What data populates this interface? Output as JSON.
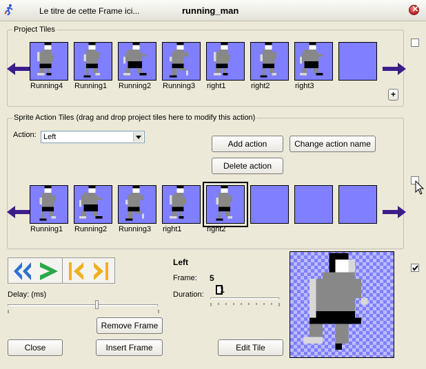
{
  "window": {
    "caption": "Le titre de cette Frame ici...",
    "title": "running_man"
  },
  "project_tiles": {
    "legend": "Project Tiles",
    "tiles": [
      {
        "label": "Running4",
        "pose": "a"
      },
      {
        "label": "Running1",
        "pose": "b"
      },
      {
        "label": "Running2",
        "pose": "c"
      },
      {
        "label": "Running3",
        "pose": "d"
      },
      {
        "label": "right1",
        "pose": "a"
      },
      {
        "label": "right2",
        "pose": "b"
      },
      {
        "label": "right3",
        "pose": "c"
      },
      {
        "label": "",
        "pose": "empty"
      }
    ],
    "add_label": "+"
  },
  "action_tiles": {
    "legend": "Sprite Action Tiles (drag and drop project tiles here to modify this action)",
    "action_label": "Action:",
    "action_value": "Left",
    "add_action": "Add action",
    "change_action_name": "Change action name",
    "delete_action": "Delete action",
    "tiles": [
      {
        "label": "Running1",
        "pose": "b"
      },
      {
        "label": "Running2",
        "pose": "c"
      },
      {
        "label": "Running3",
        "pose": "d"
      },
      {
        "label": "right1",
        "pose": "a"
      },
      {
        "label": "right2",
        "pose": "b"
      },
      {
        "label": "",
        "pose": "empty"
      },
      {
        "label": "",
        "pose": "empty"
      },
      {
        "label": "",
        "pose": "empty"
      }
    ],
    "selected_index": 4
  },
  "playback": {
    "delay_label": "Delay: (ms)",
    "delay_level": 0.59,
    "remove_frame": "Remove Frame",
    "insert_frame": "Insert Frame",
    "close": "Close",
    "icons": [
      "rewind-icon",
      "play-icon",
      "first-frame-icon",
      "last-frame-icon"
    ]
  },
  "frame_info": {
    "action_name": "Left",
    "frame_label": "Frame:",
    "frame_value": "5",
    "duration_label": "Duration:",
    "duration_value": "1",
    "duration_level": 0.05,
    "edit_tile": "Edit Tile"
  },
  "colors": {
    "tile_bg": "#7f7fff",
    "arrow": "#3d1d8c",
    "play": "#2aa84a",
    "rewind": "#2f6fd0",
    "frame_nav": "#f0b020"
  }
}
